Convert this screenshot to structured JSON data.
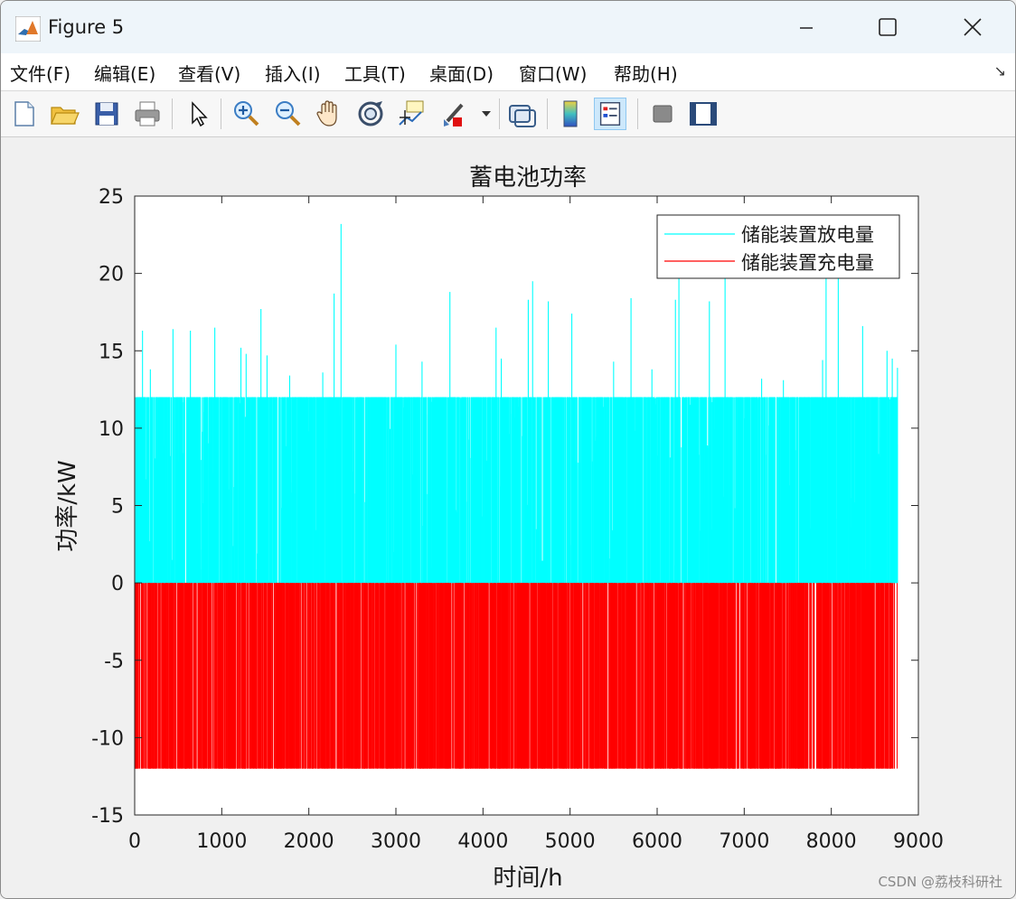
{
  "window": {
    "title": "Figure 5"
  },
  "menu": {
    "items": [
      "文件(F)",
      "编辑(E)",
      "查看(V)",
      "插入(I)",
      "工具(T)",
      "桌面(D)",
      "窗口(W)",
      "帮助(H)"
    ]
  },
  "toolbar": {
    "buttons": [
      "new-figure",
      "open-file",
      "save",
      "print",
      "pointer",
      "zoom-in",
      "zoom-out",
      "pan",
      "rotate-3d",
      "data-cursor",
      "brush",
      "link-plot",
      "colorbar",
      "legend",
      "hide-tools",
      "show-tools"
    ]
  },
  "chart_data": {
    "type": "bar",
    "title": "蓄电池功率",
    "xlabel": "时间/h",
    "ylabel": "功率/kW",
    "xlim": [
      0,
      9000
    ],
    "ylim": [
      -15,
      25
    ],
    "xticks": [
      "0",
      "1000",
      "2000",
      "3000",
      "4000",
      "5000",
      "6000",
      "7000",
      "8000",
      "9000"
    ],
    "yticks": [
      "25",
      "20",
      "15",
      "10",
      "5",
      "0",
      "-5",
      "-10",
      "-15"
    ],
    "legend_position": "top-right",
    "series": [
      {
        "name": "储能装置放电量",
        "color": "#00ffff",
        "description_of_values": "hourly discharge power, mostly capped at 12 kW with spikes",
        "max_plateau": 12,
        "spikes": [
          {
            "x": 90,
            "y": 16.3
          },
          {
            "x": 180,
            "y": 13.8
          },
          {
            "x": 440,
            "y": 16.4
          },
          {
            "x": 640,
            "y": 16.3
          },
          {
            "x": 920,
            "y": 16.5
          },
          {
            "x": 1220,
            "y": 15.2
          },
          {
            "x": 1280,
            "y": 14.8
          },
          {
            "x": 1450,
            "y": 17.7
          },
          {
            "x": 1520,
            "y": 14.7
          },
          {
            "x": 1780,
            "y": 13.4
          },
          {
            "x": 2160,
            "y": 13.6
          },
          {
            "x": 2290,
            "y": 18.7
          },
          {
            "x": 2370,
            "y": 23.2
          },
          {
            "x": 3000,
            "y": 15.4
          },
          {
            "x": 3300,
            "y": 14.3
          },
          {
            "x": 3620,
            "y": 18.8
          },
          {
            "x": 4150,
            "y": 16.5
          },
          {
            "x": 4210,
            "y": 14.5
          },
          {
            "x": 4520,
            "y": 18.3
          },
          {
            "x": 4570,
            "y": 19.5
          },
          {
            "x": 4750,
            "y": 18.2
          },
          {
            "x": 5020,
            "y": 17.4
          },
          {
            "x": 5500,
            "y": 14.3
          },
          {
            "x": 5700,
            "y": 18.4
          },
          {
            "x": 5940,
            "y": 13.8
          },
          {
            "x": 6210,
            "y": 18.3
          },
          {
            "x": 6250,
            "y": 20.0
          },
          {
            "x": 6600,
            "y": 18.2
          },
          {
            "x": 6780,
            "y": 19.8
          },
          {
            "x": 7200,
            "y": 13.2
          },
          {
            "x": 7450,
            "y": 13.1
          },
          {
            "x": 7900,
            "y": 14.4
          },
          {
            "x": 7940,
            "y": 19.9
          },
          {
            "x": 8080,
            "y": 19.8
          },
          {
            "x": 8360,
            "y": 16.6
          },
          {
            "x": 8640,
            "y": 15.0
          },
          {
            "x": 8700,
            "y": 14.5
          },
          {
            "x": 8760,
            "y": 13.9
          }
        ]
      },
      {
        "name": "储能装置充电量",
        "color": "#ff0000",
        "description_of_values": "hourly charge power, mostly at -12 kW",
        "min_plateau": -12
      }
    ]
  },
  "watermark": "CSDN @荔枝科研社"
}
